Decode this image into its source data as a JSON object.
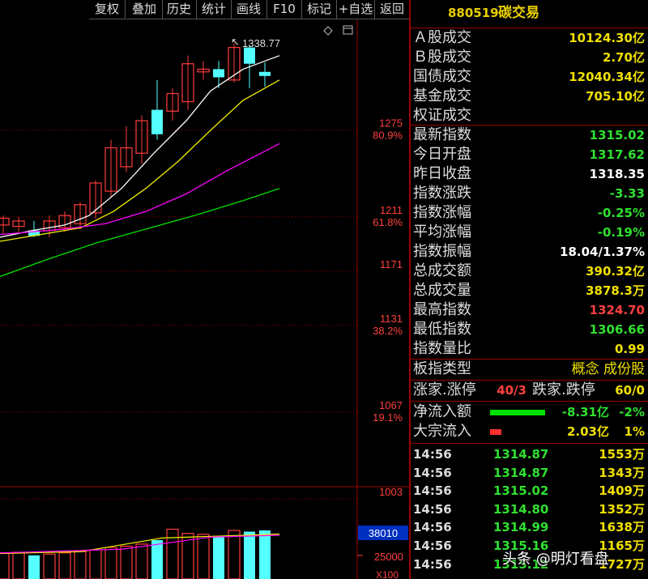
{
  "toolbar": {
    "items": [
      "复权",
      "叠加",
      "历史",
      "统计",
      "画线",
      "F10",
      "标记",
      "+自选",
      "返回"
    ]
  },
  "chart": {
    "high_label": "1338.77",
    "price_levels": [
      {
        "price": "1275",
        "pct": "80.9%"
      },
      {
        "price": "1211",
        "pct": "61.8%"
      },
      {
        "price": "1171",
        "pct": ""
      },
      {
        "price": "1131",
        "pct": "38.2%"
      },
      {
        "price": "1067",
        "pct": "19.1%"
      },
      {
        "price": "1003",
        "pct": ""
      }
    ],
    "volume_box_label": "38010",
    "volume_axis_label": "25000",
    "volume_axis_unit": "X100",
    "icons": [
      "diamond-icon",
      "window-icon"
    ],
    "colors": {
      "up": "#ff3c3c",
      "down": "#54ffff",
      "ma5": "#ffffff",
      "ma10": "#f0f000",
      "ma20": "#ff00ff",
      "ma60": "#00e000",
      "grid": "#a00000"
    }
  },
  "panel": {
    "code": "880519",
    "name": "碳交易",
    "stats": [
      {
        "label": "Ａ股成交",
        "value": "10124.30亿",
        "color": "#f0e000"
      },
      {
        "label": "Ｂ股成交",
        "value": "2.70亿",
        "color": "#f0e000"
      },
      {
        "label": "国债成交",
        "value": "12040.34亿",
        "color": "#f0e000"
      },
      {
        "label": "基金成交",
        "value": "705.10亿",
        "color": "#f0e000"
      },
      {
        "label": "权证成交",
        "value": "",
        "color": "#f0e000"
      },
      {
        "label": "最新指数",
        "value": "1315.02",
        "color": "#30e030"
      },
      {
        "label": "今日开盘",
        "value": "1317.62",
        "color": "#30e030"
      },
      {
        "label": "昨日收盘",
        "value": "1318.35",
        "color": "#ffffff"
      },
      {
        "label": "指数涨跌",
        "value": "-3.33",
        "color": "#30e030"
      },
      {
        "label": "指数涨幅",
        "value": "-0.25%",
        "color": "#30e030"
      },
      {
        "label": "平均涨幅",
        "value": "-0.19%",
        "color": "#30e030"
      },
      {
        "label": "指数振幅",
        "value": "18.04/1.37%",
        "color": "#ffffff"
      },
      {
        "label": "总成交额",
        "value": "390.32亿",
        "color": "#f0e000"
      },
      {
        "label": "总成交量",
        "value": "3878.3万",
        "color": "#f0e000"
      },
      {
        "label": "最高指数",
        "value": "1324.70",
        "color": "#ff4040"
      },
      {
        "label": "最低指数",
        "value": "1306.66",
        "color": "#30e030"
      },
      {
        "label": "指数量比",
        "value": "0.99",
        "color": "#f0e000"
      }
    ],
    "board_type": {
      "label": "板指类型",
      "value": "概念 成份股"
    },
    "breadth": {
      "up_label": "涨家.涨停",
      "up_value": "40/3",
      "down_label": "跌家.跌停",
      "down_value": "60/0"
    },
    "net_inflow": {
      "label": "净流入额",
      "value": "-8.31亿",
      "pct": "-2%",
      "ratio": 0.75
    },
    "block_inflow": {
      "label": "大宗流入",
      "value": "2.03亿",
      "pct": "1%",
      "ratio": 0.15
    },
    "ticks": [
      {
        "time": "14:56",
        "price": "1314.87",
        "vol": "1553万"
      },
      {
        "time": "14:56",
        "price": "1314.87",
        "vol": "1343万"
      },
      {
        "time": "14:56",
        "price": "1315.02",
        "vol": "1409万"
      },
      {
        "time": "14:56",
        "price": "1314.80",
        "vol": "1352万"
      },
      {
        "time": "14:56",
        "price": "1314.99",
        "vol": "1638万"
      },
      {
        "time": "14:56",
        "price": "1315.16",
        "vol": "1165万"
      },
      {
        "time": "14:56",
        "price": "1315.12",
        "vol": "1727万"
      }
    ]
  },
  "watermark": "头条 @明灯看盘",
  "chart_data": {
    "type": "candlestick",
    "ylim": [
      990,
      1345
    ],
    "candles": [
      {
        "o": 1205,
        "h": 1212,
        "l": 1198,
        "c": 1210,
        "up": true
      },
      {
        "o": 1204,
        "h": 1211,
        "l": 1200,
        "c": 1208,
        "up": true
      },
      {
        "o": 1201,
        "h": 1208,
        "l": 1196,
        "c": 1197,
        "up": false
      },
      {
        "o": 1201,
        "h": 1212,
        "l": 1196,
        "c": 1208,
        "up": true
      },
      {
        "o": 1203,
        "h": 1215,
        "l": 1200,
        "c": 1212,
        "up": true
      },
      {
        "o": 1206,
        "h": 1222,
        "l": 1202,
        "c": 1220,
        "up": true
      },
      {
        "o": 1214,
        "h": 1238,
        "l": 1210,
        "c": 1236,
        "up": true
      },
      {
        "o": 1230,
        "h": 1268,
        "l": 1226,
        "c": 1262,
        "up": true
      },
      {
        "o": 1248,
        "h": 1278,
        "l": 1244,
        "c": 1262,
        "up": true
      },
      {
        "o": 1258,
        "h": 1286,
        "l": 1250,
        "c": 1282,
        "up": true
      },
      {
        "o": 1272,
        "h": 1312,
        "l": 1268,
        "c": 1290,
        "up": false
      },
      {
        "o": 1289,
        "h": 1306,
        "l": 1282,
        "c": 1302,
        "up": true
      },
      {
        "o": 1296,
        "h": 1330,
        "l": 1290,
        "c": 1324,
        "up": true
      },
      {
        "o": 1318,
        "h": 1326,
        "l": 1312,
        "c": 1320,
        "up": true
      },
      {
        "o": 1314,
        "h": 1326,
        "l": 1306,
        "c": 1320,
        "up": false
      },
      {
        "o": 1312,
        "h": 1339,
        "l": 1310,
        "c": 1336,
        "up": true
      },
      {
        "o": 1336,
        "h": 1338,
        "l": 1306,
        "c": 1324,
        "up": false
      },
      {
        "o": 1318,
        "h": 1325,
        "l": 1307,
        "c": 1315,
        "up": false
      }
    ],
    "volumes": [
      30500,
      30800,
      29800,
      30200,
      30600,
      31000,
      31600,
      32400,
      32800,
      33500,
      34800,
      38400,
      37000,
      36700,
      36200,
      38000,
      37600,
      38010
    ]
  }
}
